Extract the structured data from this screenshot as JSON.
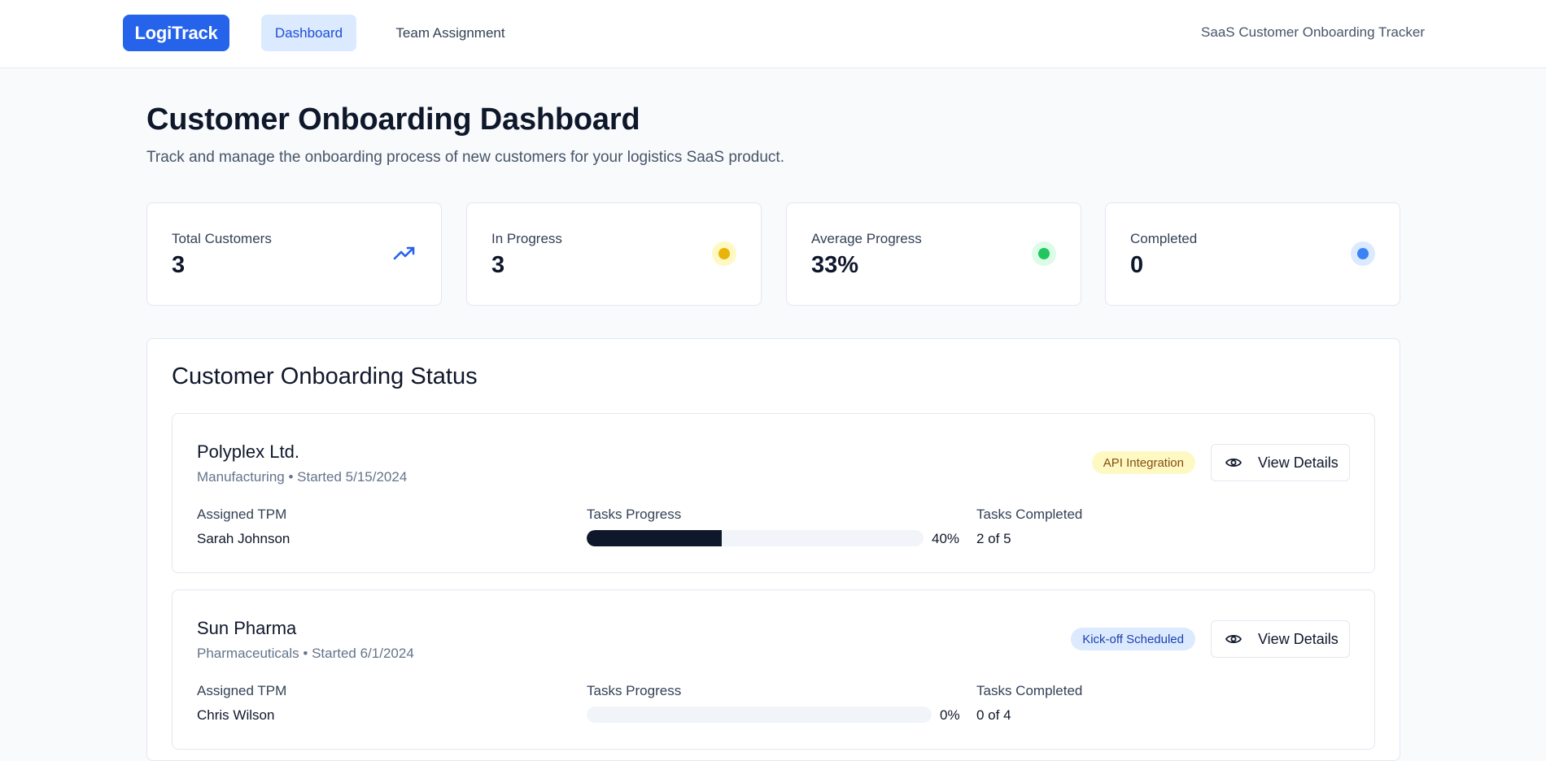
{
  "nav": {
    "logo": "LogiTrack",
    "items": [
      {
        "label": "Dashboard",
        "active": true
      },
      {
        "label": "Team Assignment",
        "active": false
      }
    ],
    "app_subtitle": "SaaS Customer Onboarding Tracker"
  },
  "header": {
    "title": "Customer Onboarding Dashboard",
    "description": "Track and manage the onboarding process of new customers for your logistics SaaS product."
  },
  "stats": [
    {
      "label": "Total Customers",
      "value": "3",
      "icon": "trending-up-icon",
      "color": "#2563eb"
    },
    {
      "label": "In Progress",
      "value": "3",
      "icon": "yellow-dot-icon",
      "color": "#eab308"
    },
    {
      "label": "Average Progress",
      "value": "33%",
      "icon": "green-dot-icon",
      "color": "#22c55e"
    },
    {
      "label": "Completed",
      "value": "0",
      "icon": "blue-dot-icon",
      "color": "#3b82f6"
    }
  ],
  "status_panel": {
    "title": "Customer Onboarding Status",
    "tpm_label": "Assigned TPM",
    "progress_label": "Tasks Progress",
    "completed_label": "Tasks Completed",
    "view_label": "View Details",
    "customers": [
      {
        "name": "Polyplex Ltd.",
        "meta": "Manufacturing • Started 5/15/2024",
        "stage": "API Integration",
        "stage_bg": "#fef9c3",
        "stage_color": "#854d0e",
        "tpm": "Sarah Johnson",
        "progress": 0.4,
        "progress_text": "40%",
        "tasks_completed": "2 of 5"
      },
      {
        "name": "Sun Pharma",
        "meta": "Pharmaceuticals • Started 6/1/2024",
        "stage": "Kick-off Scheduled",
        "stage_bg": "#dbeafe",
        "stage_color": "#1e40af",
        "tpm": "Chris Wilson",
        "progress": 0,
        "progress_text": "0%",
        "tasks_completed": "0 of 4"
      }
    ]
  }
}
